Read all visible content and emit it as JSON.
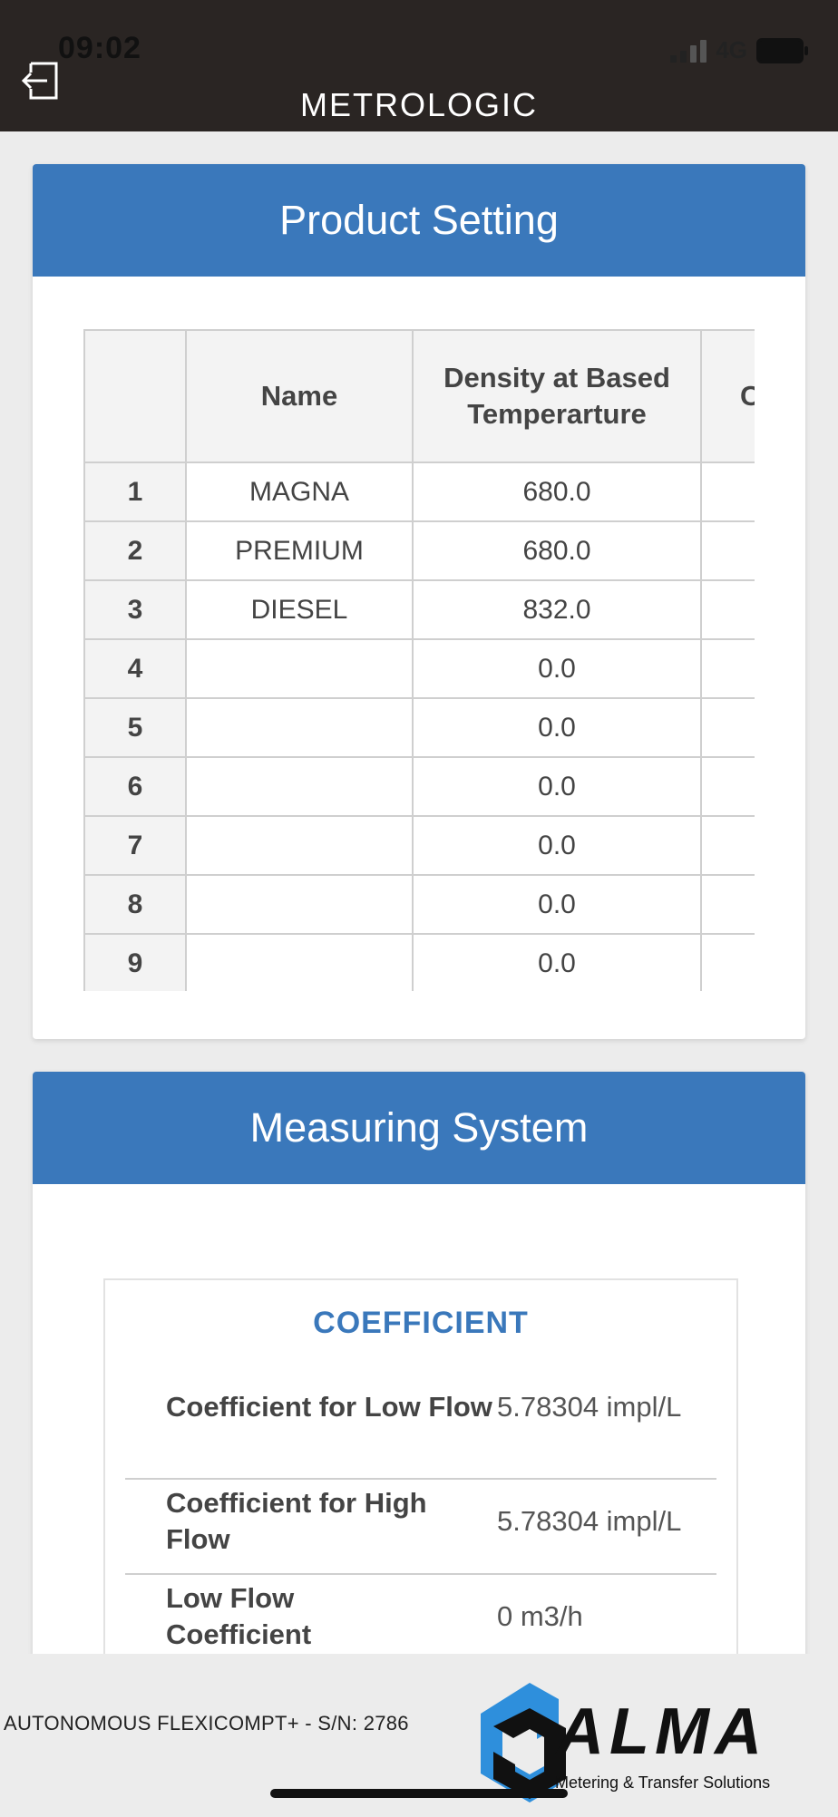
{
  "status": {
    "time": "09:02",
    "network": "4G"
  },
  "header": {
    "title": "METROLOGIC"
  },
  "product_setting": {
    "title": "Product Setting",
    "columns": [
      "",
      "Name",
      "Density at Based Temperarture",
      "C"
    ],
    "rows": [
      {
        "idx": "1",
        "name": "MAGNA",
        "density": "680.0"
      },
      {
        "idx": "2",
        "name": "PREMIUM",
        "density": "680.0"
      },
      {
        "idx": "3",
        "name": "DIESEL",
        "density": "832.0"
      },
      {
        "idx": "4",
        "name": "",
        "density": "0.0"
      },
      {
        "idx": "5",
        "name": "",
        "density": "0.0"
      },
      {
        "idx": "6",
        "name": "",
        "density": "0.0"
      },
      {
        "idx": "7",
        "name": "",
        "density": "0.0"
      },
      {
        "idx": "8",
        "name": "",
        "density": "0.0"
      },
      {
        "idx": "9",
        "name": "",
        "density": "0.0"
      }
    ]
  },
  "measuring_system": {
    "title": "Measuring System",
    "coefficient": {
      "title": "COEFFICIENT",
      "items": [
        {
          "label": "Coefficient for Low Flow",
          "value": "5.78304 impl/L"
        },
        {
          "label": "Coefficient for High Flow",
          "value": "5.78304 impl/L"
        },
        {
          "label": "Low Flow Coefficient",
          "value": "0 m3/h"
        }
      ]
    }
  },
  "footer": {
    "device": "AUTONOMOUS FLEXICOMPT+ - S/N: 2786",
    "brand": "ALMA",
    "tagline": "Metering & Transfer Solutions"
  },
  "colors": {
    "accent": "#3a78bb",
    "topbar": "#2a2523",
    "logo_blue": "#2e8fdc"
  }
}
